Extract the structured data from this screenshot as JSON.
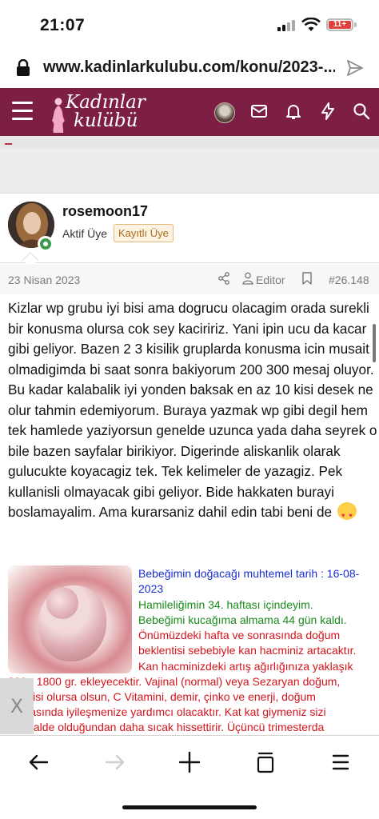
{
  "status_bar": {
    "time": "21:07",
    "battery": "11+"
  },
  "browser": {
    "url": "www.kadinlarkulubu.com/konu/2023-..."
  },
  "site": {
    "logo_line1": "Kadınlar",
    "logo_line2": "kulübü"
  },
  "post": {
    "username": "rosemoon17",
    "user_title": "Aktif Üye",
    "user_badge": "Kayıtlı Üye",
    "date": "23 Nisan 2023",
    "editor_label": "Editor",
    "number": "#26.148",
    "body": "Kizlar wp grubu iyi bisi ama dogrucu olacagim orada surekli bir konusma olursa cok sey kaciririz. Yani ipin ucu da kacar gibi geliyor. Bazen 2 3 kisilik gruplarda konusma icin musait olmadigimda bi saat sonra bakiyorum 200 300 mesaj oluyor. Bu kadar kalabalik iyi yonden baksak en az 10 kisi desek ne olur tahmin edemiyorum. Buraya yazmak wp gibi degil hem tek hamlede yaziyorsun genelde uzunca yada daha seyrek o bile bazen sayfalar birikiyor. Digerinde aliskanlik olarak gulucukte koyacagiz tek. Tek kelimeler de yazagiz. Pek kullanisli olmayacak gibi geliyor. Bide hakkaten burayi boslamayalim. Ama kurarsaniz dahil edin tabi beni de",
    "emoji": "smiling-face-with-hearts"
  },
  "ticker": {
    "line1": "Bebeğimin doğacağı muhtemel tarih : 16-08-",
    "line2": "2023",
    "line3": "Hamileliğimin 34. haftası içindeyim.",
    "line4": "Bebeğimi kucağıma almama 44 gün kaldı.",
    "line5": "Önümüzdeki hafta ve sonrasında doğum",
    "line6": "beklentisi sebebiyle kan hacminiz artacaktır.",
    "line7": "Kan hacminizdeki artış ağırlığınıza yaklaşık",
    "line8": "200 - 1800 gr. ekleyecektir. Vajinal (normal) veya Sezaryan doğum,",
    "line9": "hangisi olursa olsun, C Vitamini, demir, çinko ve enerji, doğum",
    "line10": "sonrasında iyileşmenize yardımcı olacaktır. Kat kat giymeniz sizi",
    "line11": "normalde olduğundan daha sıcak hissettirir. Üçüncü trimesterda"
  },
  "close_label": "X",
  "colors": {
    "header": "#7d1f45",
    "ticker_blue": "#1b2fcf",
    "ticker_green": "#1b8a1b",
    "ticker_red": "#d4141c"
  },
  "icons": [
    "lock-icon",
    "share-icon",
    "menu-icon",
    "mail-icon",
    "bell-icon",
    "bolt-icon",
    "search-icon",
    "share-nodes-icon",
    "user-icon",
    "bookmark-icon",
    "back-icon",
    "forward-icon",
    "plus-icon",
    "tabs-icon",
    "hamburger-icon"
  ]
}
